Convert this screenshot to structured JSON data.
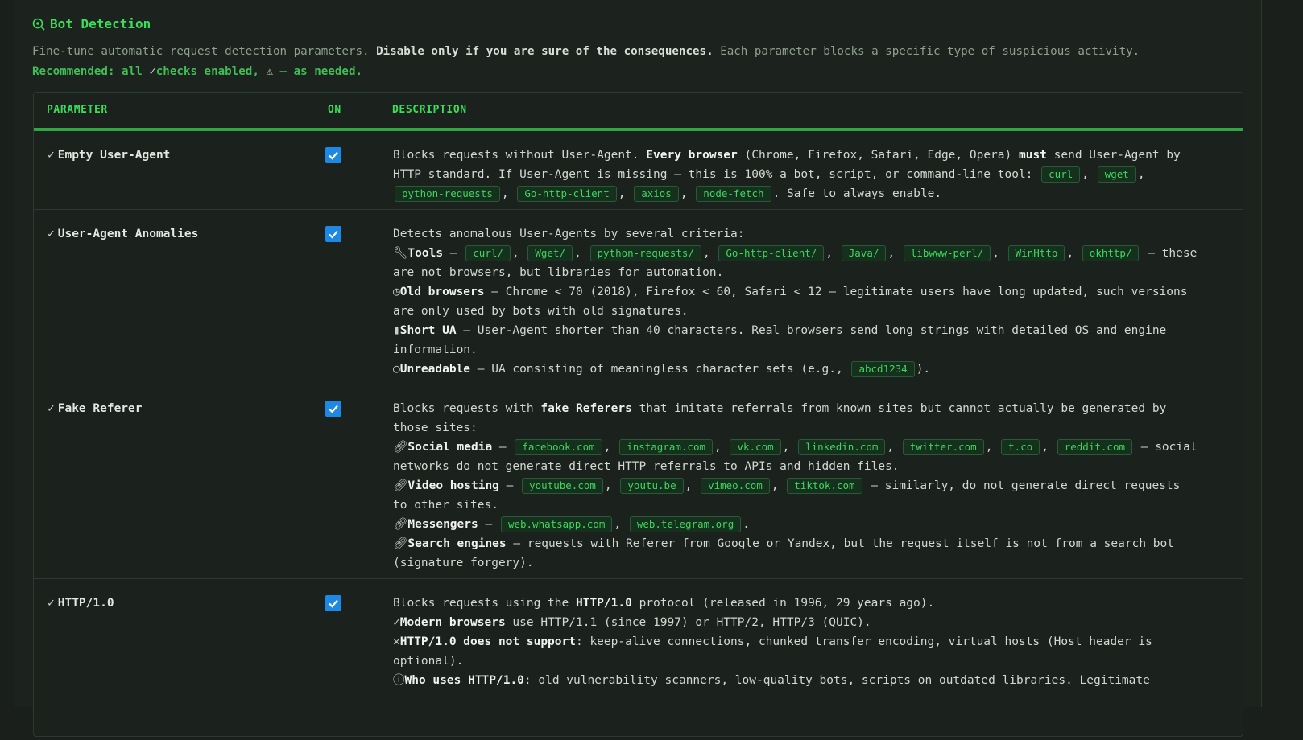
{
  "section": {
    "title": "Bot Detection",
    "intro_1": "Fine-tune automatic request detection parameters.",
    "intro_bold": "Disable only if you are sure of the consequences.",
    "intro_2": "Each parameter blocks a specific type of suspicious activity.",
    "recommended_a": "Recommended: all",
    "recommended_b": "checks enabled,",
    "recommended_c": "— as needed."
  },
  "table": {
    "headers": {
      "parameter": "PARAMETER",
      "on": "ON",
      "description": "DESCRIPTION"
    },
    "rows": [
      {
        "name": "Empty User-Agent",
        "enabled": true,
        "d1": "Blocks requests without User-Agent.",
        "d1b": "Every browser",
        "d2": "(Chrome, Firefox, Safari, Edge, Opera)",
        "d2b": "must",
        "d3": "send User-Agent by HTTP standard. If User-Agent is missing — this is 100% a bot, script, or command-line tool:",
        "tools": [
          "curl",
          "wget",
          "python-requests",
          "Go-http-client",
          "axios",
          "node-fetch"
        ],
        "d4": ". Safe to always enable."
      },
      {
        "name": "User-Agent Anomalies",
        "enabled": true,
        "intro": "Detects anomalous User-Agents by several criteria:",
        "tools_label": "Tools",
        "tools": [
          "curl/",
          "Wget/",
          "python-requests/",
          "Go-http-client/",
          "Java/",
          "libwww-perl/",
          "WinHttp",
          "okhttp/"
        ],
        "tools_tail": "— these are not browsers, but libraries for automation.",
        "old_label": "Old browsers",
        "old_text": "— Chrome < 70 (2018), Firefox < 60, Safari < 12 — legitimate users have long updated, such versions are only used by bots with old signatures.",
        "short_label": "Short UA",
        "short_text": "— User-Agent shorter than 40 characters. Real browsers send long strings with detailed OS and engine information.",
        "unread_label": "Unreadable",
        "unread_text": "— UA consisting of meaningless character sets (e.g.,",
        "unread_code": "abcd1234",
        "unread_tail": ")."
      },
      {
        "name": "Fake Referer",
        "enabled": true,
        "intro_a": "Blocks requests with",
        "intro_b": "fake Referers",
        "intro_c": "that imitate referrals from known sites but cannot actually be generated by those sites:",
        "social_label": "Social media",
        "social": [
          "facebook.com",
          "instagram.com",
          "vk.com",
          "linkedin.com",
          "twitter.com",
          "t.co",
          "reddit.com"
        ],
        "social_tail": "— social networks do not generate direct HTTP referrals to APIs and hidden files.",
        "video_label": "Video hosting",
        "video": [
          "youtube.com",
          "youtu.be",
          "vimeo.com",
          "tiktok.com"
        ],
        "video_tail": "— similarly, do not generate direct requests to other sites.",
        "msg_label": "Messengers",
        "msg": [
          "web.whatsapp.com",
          "web.telegram.org"
        ],
        "search_label": "Search engines",
        "search_text": "— requests with Referer from Google or Yandex, but the request itself is not from a search bot (signature forgery)."
      },
      {
        "name": "HTTP/1.0",
        "enabled": true,
        "intro_a": "Blocks requests using the",
        "intro_b": "HTTP/1.0",
        "intro_c": "protocol (released in 1996, 29 years ago).",
        "modern_label": "Modern browsers",
        "modern_text": "use HTTP/1.1 (since 1997) or HTTP/2, HTTP/3 (QUIC).",
        "nosup_label": "HTTP/1.0 does not support",
        "nosup_text": ": keep-alive connections, chunked transfer encoding, virtual hosts (Host header is optional).",
        "who_label": "Who uses HTTP/1.0",
        "who_text": ": old vulnerability scanners, low-quality bots, scripts on outdated libraries. Legitimate"
      }
    ]
  },
  "icons": {
    "title": "search-shield-icon",
    "check": "checkmark-icon",
    "warn": "warning-triangle-icon",
    "wrench": "wrench-icon",
    "clock": "clock-icon",
    "bars": "bar-chart-icon",
    "drop": "drop-icon",
    "link": "link-icon",
    "cross": "cross-icon",
    "info": "info-circle-icon"
  },
  "colors": {
    "accent": "#3ddc5a",
    "checkbox": "#1e88e5",
    "code_bg": "#15301c"
  }
}
